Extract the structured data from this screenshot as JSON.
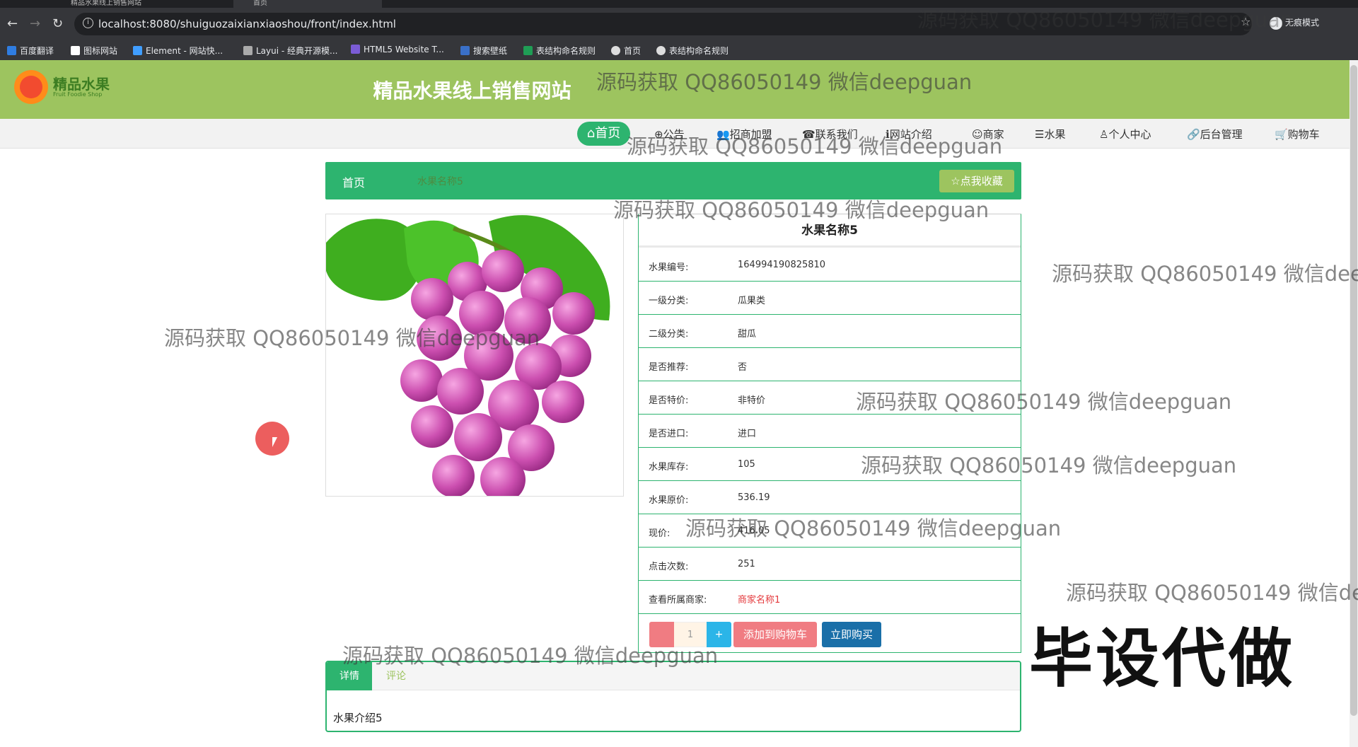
{
  "browser": {
    "tabs": [
      {
        "label": "精品水果线上销售网站",
        "active": false
      },
      {
        "label": "首页",
        "active": true
      }
    ],
    "url": "localhost:8080/shuiguozaixianxiaoshou/front/index.html",
    "incognito_label": "无痕模式",
    "bookmarks": [
      "百度翻译",
      "图标网站",
      "Element - 网站快...",
      "Layui - 经典开源模...",
      "HTML5 Website T...",
      "搜索壁纸",
      "表结构命名规则",
      "首页",
      "表结构命名规则"
    ]
  },
  "header": {
    "logo_text": "精品水果",
    "logo_sub": "Fruit Foodie Shop",
    "site_title": "精品水果线上销售网站"
  },
  "nav": {
    "home": "⌂首页",
    "items": [
      "⊕公告",
      "👥招商加盟",
      "☎联系我们",
      "ℹ网站介绍",
      "☺商家",
      "☰水果",
      "♙个人中心",
      "🔗后台管理",
      "🛒购物车"
    ]
  },
  "breadcrumb": {
    "home": "首页",
    "current": "水果名称5",
    "favorite_label": "☆点我收藏"
  },
  "product": {
    "title": "水果名称5",
    "fields": [
      {
        "label": "水果编号:",
        "value": "164994190825810"
      },
      {
        "label": "一级分类:",
        "value": "瓜果类"
      },
      {
        "label": "二级分类:",
        "value": "甜瓜"
      },
      {
        "label": "是否推荐:",
        "value": "否"
      },
      {
        "label": "是否特价:",
        "value": "非特价"
      },
      {
        "label": "是否进口:",
        "value": "进口"
      },
      {
        "label": "水果库存:",
        "value": "105"
      },
      {
        "label": "水果原价:",
        "value": "536.19"
      },
      {
        "label": "现价:",
        "value": "416.05"
      },
      {
        "label": "点击次数:",
        "value": "251"
      },
      {
        "label": "查看所属商家:",
        "value": "商家名称1"
      }
    ],
    "quantity": "1",
    "add_to_cart": "添加到购物车",
    "buy_now": "立即购买"
  },
  "tabs": {
    "detail": "详情",
    "comment": "评论",
    "content": "水果介绍5"
  },
  "watermark": {
    "text": "源码获取 QQ86050149 微信deepguan",
    "big": "毕设代做"
  },
  "colors": {
    "header_green": "#9dc45f",
    "primary_green": "#2db46f",
    "pink": "#f07c82",
    "blue": "#1a6fa8"
  }
}
